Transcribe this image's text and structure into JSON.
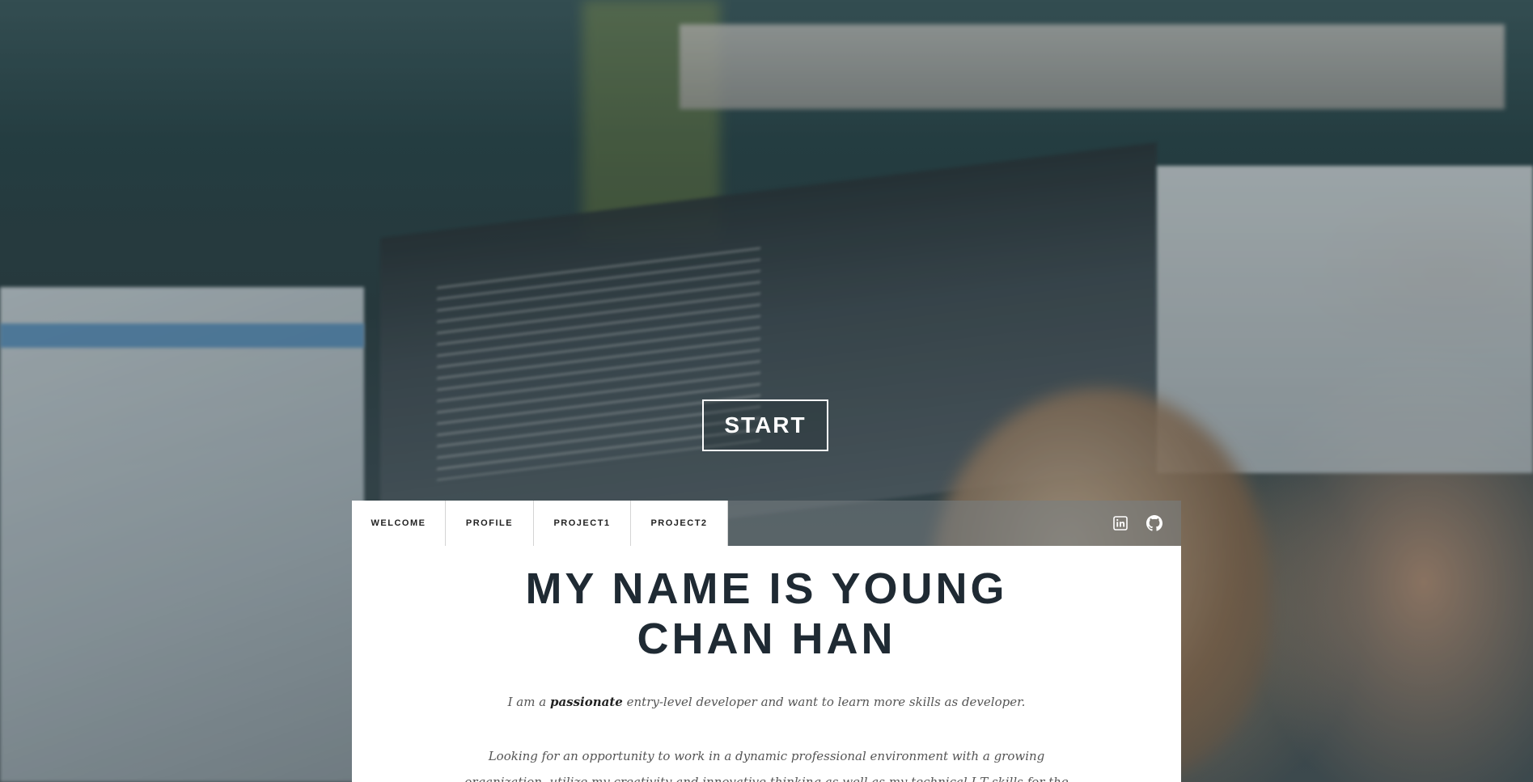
{
  "hero": {
    "start_label": "START"
  },
  "nav": {
    "tabs": [
      {
        "label": "WELCOME"
      },
      {
        "label": "PROFILE"
      },
      {
        "label": "PROJECT1"
      },
      {
        "label": "PROJECT2"
      }
    ],
    "icons": [
      {
        "name": "linkedin-icon"
      },
      {
        "name": "github-icon"
      }
    ]
  },
  "welcome": {
    "title": "MY NAME IS YOUNG CHAN HAN",
    "intro_prefix": "I am a ",
    "intro_emphasis": "passionate",
    "intro_suffix": " entry-level developer and want to learn more skills as developer.",
    "objective": "Looking for an opportunity to work in a dynamic professional environment with a growing organization, utilize my creativity and innovative thinking as well as my technical I.T skills for the benefit of the organization."
  }
}
